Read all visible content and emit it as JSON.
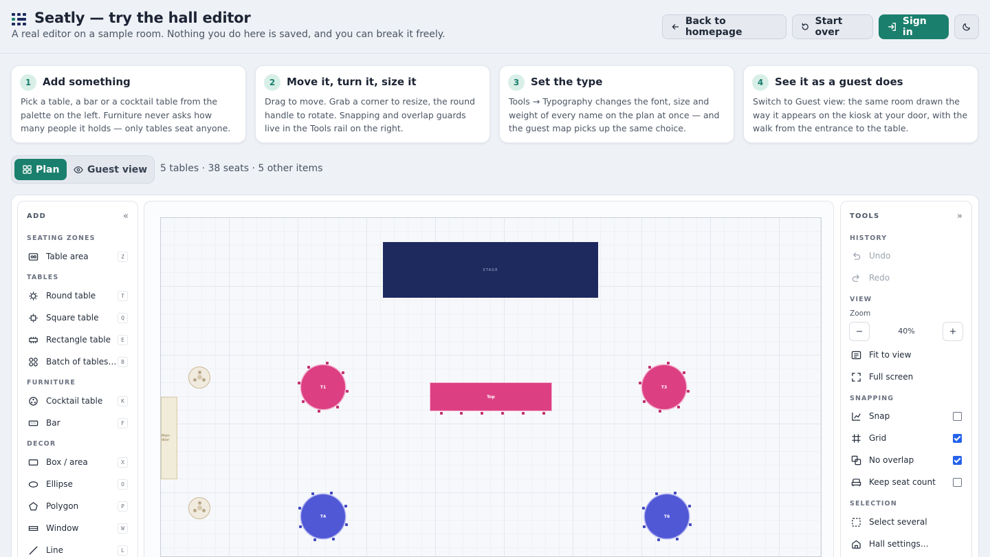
{
  "header": {
    "title": "Seatly — try the hall editor",
    "subtitle": "A real editor on a sample room. Nothing you do here is saved, and you can break it freely.",
    "back_label": "Back to homepage",
    "start_over_label": "Start over",
    "sign_in_label": "Sign in",
    "accent": "#1b7f6d"
  },
  "steps": [
    {
      "num": "1",
      "title": "Add something",
      "body": "Pick a table, a bar or a cocktail table from the palette on the left. Furniture never asks how many people it holds — only tables seat anyone."
    },
    {
      "num": "2",
      "title": "Move it, turn it, size it",
      "body": "Drag to move. Grab a corner to resize, the round handle to rotate. Snapping and overlap guards live in the Tools rail on the right."
    },
    {
      "num": "3",
      "title": "Set the type",
      "body": "Tools → Typography changes the font, size and weight of every name on the plan at once — and the guest map picks up the same choice."
    },
    {
      "num": "4",
      "title": "See it as a guest does",
      "body": "Switch to Guest view: the same room drawn the way it appears on the kiosk at your door, with the walk from the entrance to the table."
    }
  ],
  "modes": {
    "plan": "Plan",
    "guest": "Guest view"
  },
  "counts": "5 tables · 38 seats · 5 other items",
  "add_panel": {
    "title": "ADD",
    "collapse": "«",
    "sections": {
      "seating": "SEATING ZONES",
      "tables": "TABLES",
      "furniture": "FURNITURE",
      "decor": "DECOR"
    },
    "items": [
      {
        "label": "Table area",
        "key": "Z",
        "icon": "table-area-icon"
      },
      {
        "label": "Round table",
        "key": "T",
        "icon": "round-table-icon"
      },
      {
        "label": "Square table",
        "key": "Q",
        "icon": "square-table-icon"
      },
      {
        "label": "Rectangle table",
        "key": "E",
        "icon": "rectangle-table-icon"
      },
      {
        "label": "Batch of tables…",
        "key": "B",
        "icon": "batch-tables-icon"
      },
      {
        "label": "Cocktail table",
        "key": "K",
        "icon": "cocktail-table-icon"
      },
      {
        "label": "Bar",
        "key": "F",
        "icon": "bar-icon"
      },
      {
        "label": "Box / area",
        "key": "X",
        "icon": "box-icon"
      },
      {
        "label": "Ellipse",
        "key": "O",
        "icon": "ellipse-icon"
      },
      {
        "label": "Polygon",
        "key": "P",
        "icon": "polygon-icon"
      },
      {
        "label": "Window",
        "key": "W",
        "icon": "window-icon"
      },
      {
        "label": "Line",
        "key": "L",
        "icon": "line-icon"
      }
    ]
  },
  "tools_panel": {
    "title": "TOOLS",
    "collapse": "»",
    "sections": {
      "history": "HISTORY",
      "view": "VIEW",
      "snapping": "SNAPPING",
      "selection": "SELECTION"
    },
    "undo": "Undo",
    "redo": "Redo",
    "zoom_label": "Zoom",
    "zoom_value": "40%",
    "zoom_minus": "−",
    "zoom_plus": "+",
    "fit": "Fit to view",
    "fullscreen": "Full screen",
    "snap": {
      "label": "Snap",
      "checked": false
    },
    "grid": {
      "label": "Grid",
      "checked": true
    },
    "no_overlap": {
      "label": "No overlap",
      "checked": true
    },
    "keep_seats": {
      "label": "Keep seat count",
      "checked": false
    },
    "select_several": "Select several",
    "hall_settings": "Hall settings…"
  },
  "canvas": {
    "stage_label": "STAGE",
    "door_label": "Main door",
    "tables": [
      {
        "id": "T1",
        "label": "T1",
        "color": "pink"
      },
      {
        "id": "Top",
        "label": "Top",
        "color": "pink"
      },
      {
        "id": "T3",
        "label": "T3",
        "color": "pink"
      },
      {
        "id": "T4",
        "label": "T4",
        "color": "blue"
      },
      {
        "id": "T6",
        "label": "T6",
        "color": "blue"
      }
    ],
    "colors": {
      "pink": "#dd3f83",
      "blue": "#5158d6",
      "stage": "#1e2a5e"
    }
  }
}
